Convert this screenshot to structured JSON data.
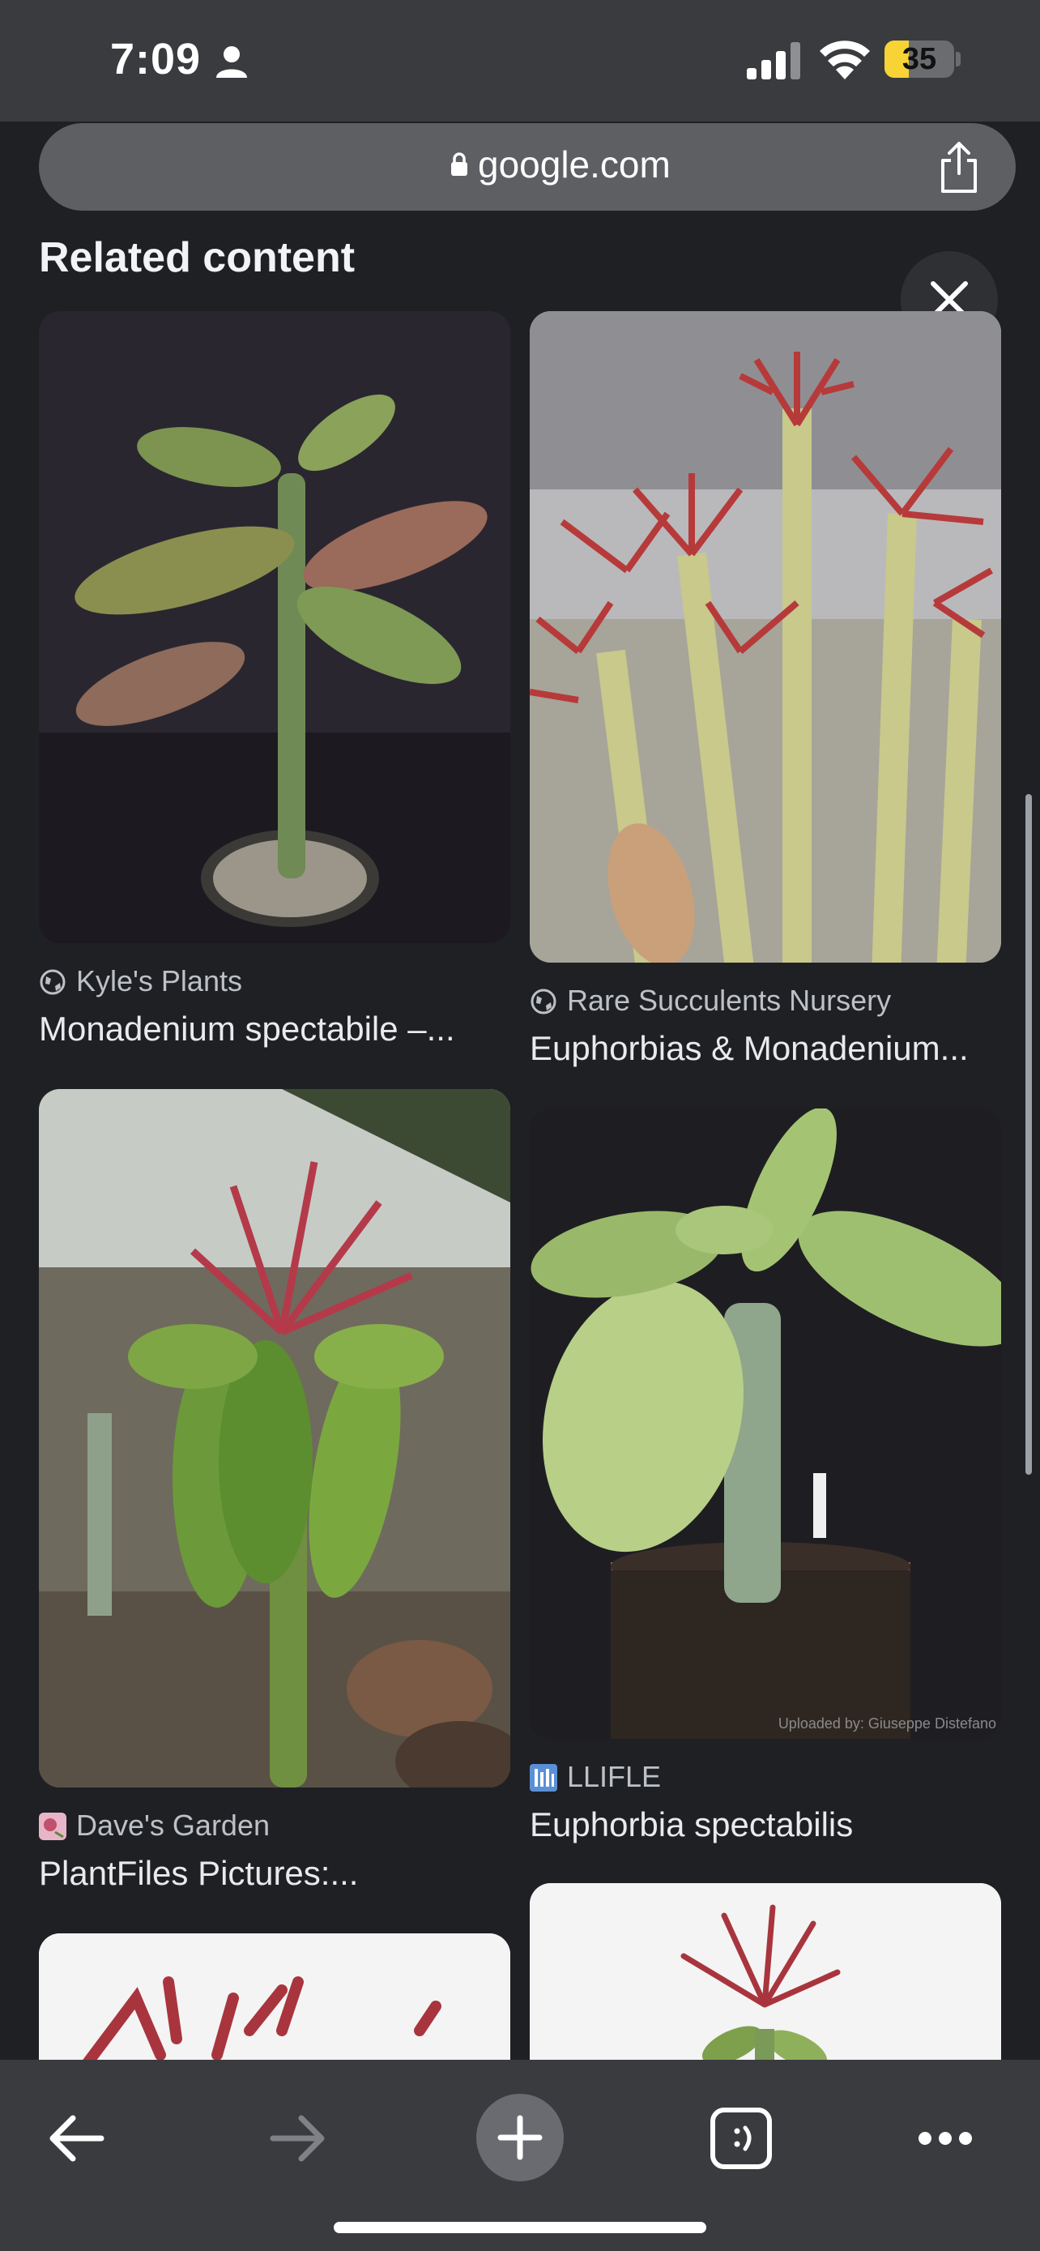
{
  "status_bar": {
    "time": "7:09",
    "battery": "35",
    "battery_level": 0.35
  },
  "browser": {
    "url": "google.com"
  },
  "panel": {
    "title": "Related content",
    "results": [
      {
        "source": "Kyle's Plants",
        "caption": "Monadenium spectabile –...",
        "source_icon": "globe-icon"
      },
      {
        "source": "Rare Succulents Nursery",
        "caption": "Euphorbias & Monadenium...",
        "source_icon": "globe-icon"
      },
      {
        "source": "Dave's Garden",
        "caption": "PlantFiles Pictures:...",
        "source_icon": "daves-garden-icon"
      },
      {
        "source": "LLIFLE",
        "caption": "Euphorbia spectabilis",
        "source_icon": "llifle-icon",
        "image_watermark": "Uploaded by: Giuseppe Distefano"
      }
    ]
  },
  "toolbar": {
    "back": "back-arrow-icon",
    "forward": "forward-arrow-icon",
    "new_tab": "plus-icon",
    "tabs": "tab-switcher-icon",
    "menu": "more-icon"
  }
}
